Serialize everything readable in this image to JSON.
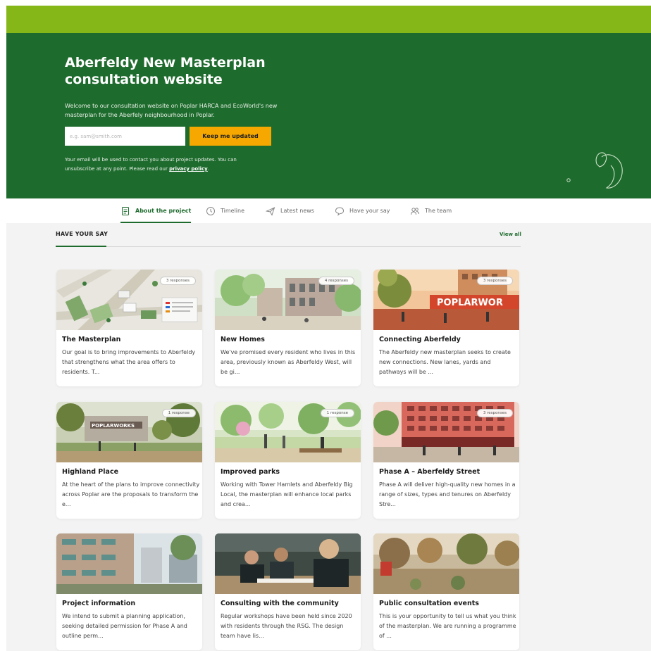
{
  "hero": {
    "title": "Aberfeldy New Masterplan consultation website",
    "intro": "Welcome to our consultation website on Poplar HARCA and EcoWorld's new masterplan for the Aberfely neighbourhood in Poplar.",
    "email_placeholder": "e.g. sam@smith.com",
    "cta_label": "Keep me updated",
    "note_text": "Your email will be used to contact you about project updates. You can unsubscribe at any point. Please read our ",
    "privacy_link": "privacy policy",
    "note_end": "."
  },
  "nav": {
    "items": [
      {
        "label": "About the project",
        "icon": "document-icon",
        "active": true
      },
      {
        "label": "Timeline",
        "icon": "clock-icon",
        "active": false
      },
      {
        "label": "Latest news",
        "icon": "paper-plane-icon",
        "active": false
      },
      {
        "label": "Have your say",
        "icon": "chat-bubble-icon",
        "active": false
      },
      {
        "label": "The team",
        "icon": "people-icon",
        "active": false
      }
    ]
  },
  "section": {
    "title": "HAVE YOUR SAY",
    "view_all": "View all"
  },
  "cards": [
    {
      "title": "The Masterplan",
      "desc": "Our goal is to bring improvements to Aberfeldy that strengthens what the area offers to residents. T...",
      "badge": "3 responses"
    },
    {
      "title": "New Homes",
      "desc": "We've promised every resident who lives in this area, previously known as Aberfeldy West, will be gi...",
      "badge": "4 responses"
    },
    {
      "title": "Connecting Aberfeldy",
      "desc": "The Aberfeldy new masterplan seeks to create new connections. New lanes, yards and pathways will be ...",
      "badge": "3 responses"
    },
    {
      "title": "Highland Place",
      "desc": "At the heart of the plans to improve connectivity across Poplar are the proposals to transform the e...",
      "badge": "1 response"
    },
    {
      "title": "Improved parks",
      "desc": "Working with Tower Hamlets and Aberfeldy Big Local, the masterplan will enhance local parks and crea...",
      "badge": "1 response"
    },
    {
      "title": "Phase A – Aberfeldy Street",
      "desc": "Phase A will deliver high-quality new homes in a range of sizes, types and tenures on Aberfeldy Stre...",
      "badge": "3 responses"
    },
    {
      "title": "Project information",
      "desc": "We intend to submit a planning application, seeking detailed permission for Phase A and outline perm...",
      "badge": ""
    },
    {
      "title": "Consulting with the community",
      "desc": "Regular workshops have been held since 2020 with residents through the RSG. The design team have lis...",
      "badge": ""
    },
    {
      "title": "Public consultation events",
      "desc": "This is your opportunity to tell us what you think of the masterplan. We are running a programme of ...",
      "badge": ""
    }
  ],
  "image_texts": {
    "poplar_sign": "POPLARWOR",
    "poplar_sign_small": "POPLARWORKS"
  },
  "colors": {
    "topbar": "#86b719",
    "hero": "#1e6b2e",
    "accent": "#f6a800"
  }
}
